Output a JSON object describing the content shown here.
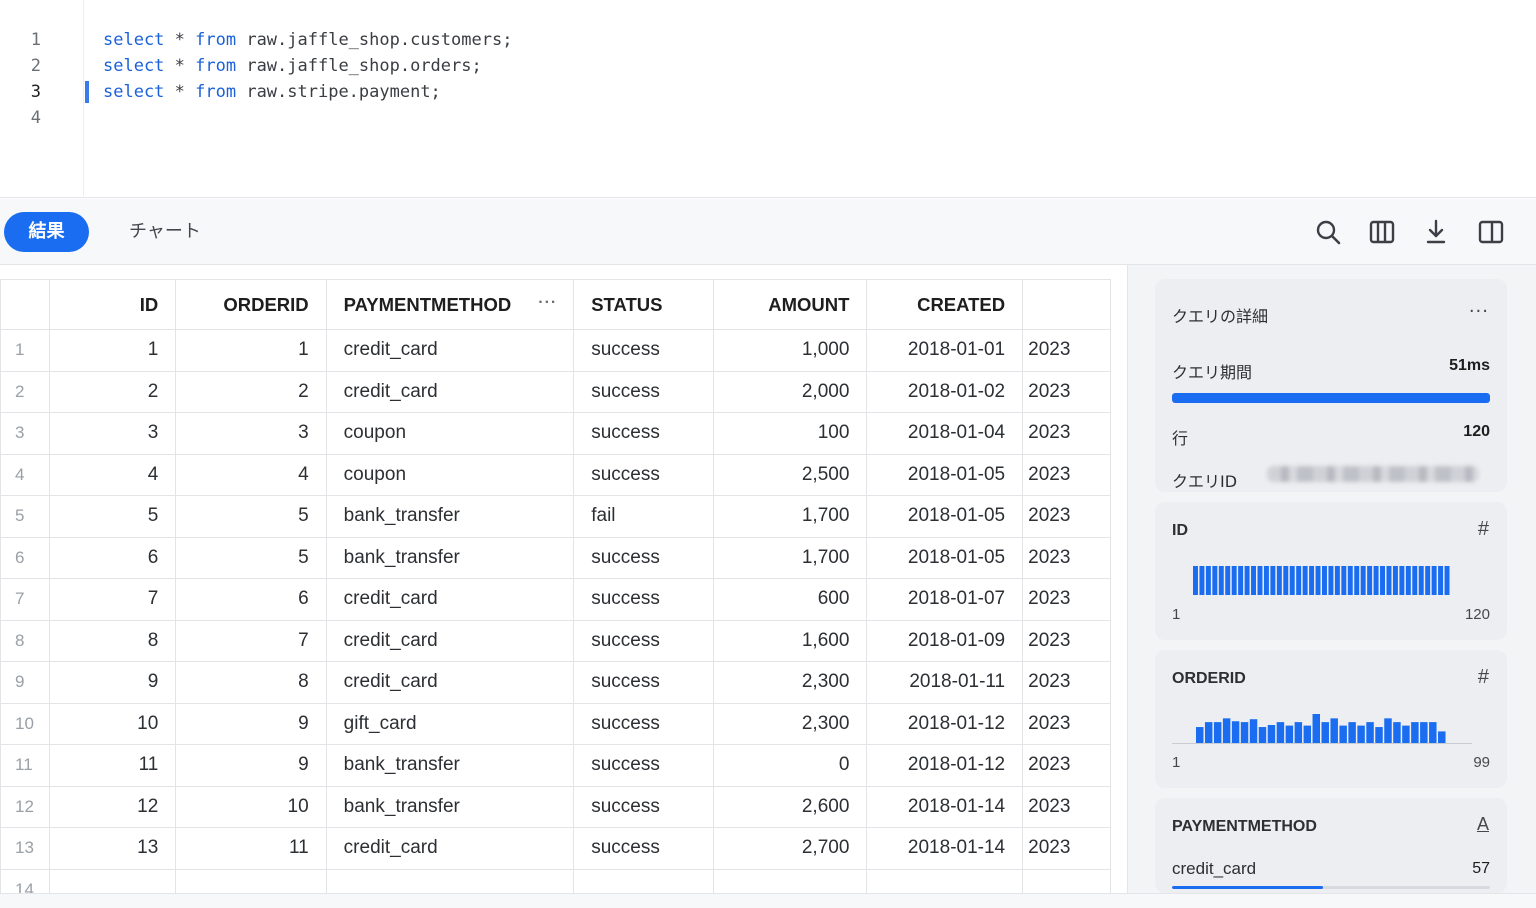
{
  "editor": {
    "lines": [
      {
        "no": "1",
        "kw1": "select",
        "star": " * ",
        "kw2": "from",
        "rest": " raw.jaffle_shop.customers;"
      },
      {
        "no": "2",
        "kw1": "select",
        "star": " * ",
        "kw2": "from",
        "rest": " raw.jaffle_shop.orders;"
      },
      {
        "no": "3",
        "kw1": "select",
        "star": " * ",
        "kw2": "from",
        "rest": " raw.stripe.payment;"
      },
      {
        "no": "4",
        "kw1": "",
        "star": "",
        "kw2": "",
        "rest": ""
      }
    ],
    "active_line": 3
  },
  "toolbar": {
    "tabs": [
      "結果",
      "チャート"
    ],
    "active_tab": "結果",
    "icons": [
      "search-icon",
      "columns-icon",
      "download-icon",
      "side-panel-icon"
    ]
  },
  "grid": {
    "columns": [
      "ID",
      "ORDERID",
      "PAYMENTMETHOD",
      "STATUS",
      "AMOUNT",
      "CREATED"
    ],
    "column_menu": "···",
    "rows": [
      {
        "rn": "1",
        "id": "1",
        "orderid": "1",
        "pm": "credit_card",
        "status": "success",
        "amount": "1,000",
        "created": "2018-01-01",
        "more": "2023"
      },
      {
        "rn": "2",
        "id": "2",
        "orderid": "2",
        "pm": "credit_card",
        "status": "success",
        "amount": "2,000",
        "created": "2018-01-02",
        "more": "2023"
      },
      {
        "rn": "3",
        "id": "3",
        "orderid": "3",
        "pm": "coupon",
        "status": "success",
        "amount": "100",
        "created": "2018-01-04",
        "more": "2023"
      },
      {
        "rn": "4",
        "id": "4",
        "orderid": "4",
        "pm": "coupon",
        "status": "success",
        "amount": "2,500",
        "created": "2018-01-05",
        "more": "2023"
      },
      {
        "rn": "5",
        "id": "5",
        "orderid": "5",
        "pm": "bank_transfer",
        "status": "fail",
        "amount": "1,700",
        "created": "2018-01-05",
        "more": "2023"
      },
      {
        "rn": "6",
        "id": "6",
        "orderid": "5",
        "pm": "bank_transfer",
        "status": "success",
        "amount": "1,700",
        "created": "2018-01-05",
        "more": "2023"
      },
      {
        "rn": "7",
        "id": "7",
        "orderid": "6",
        "pm": "credit_card",
        "status": "success",
        "amount": "600",
        "created": "2018-01-07",
        "more": "2023"
      },
      {
        "rn": "8",
        "id": "8",
        "orderid": "7",
        "pm": "credit_card",
        "status": "success",
        "amount": "1,600",
        "created": "2018-01-09",
        "more": "2023"
      },
      {
        "rn": "9",
        "id": "9",
        "orderid": "8",
        "pm": "credit_card",
        "status": "success",
        "amount": "2,300",
        "created": "2018-01-11",
        "more": "2023"
      },
      {
        "rn": "10",
        "id": "10",
        "orderid": "9",
        "pm": "gift_card",
        "status": "success",
        "amount": "2,300",
        "created": "2018-01-12",
        "more": "2023"
      },
      {
        "rn": "11",
        "id": "11",
        "orderid": "9",
        "pm": "bank_transfer",
        "status": "success",
        "amount": "0",
        "created": "2018-01-12",
        "more": "2023"
      },
      {
        "rn": "12",
        "id": "12",
        "orderid": "10",
        "pm": "bank_transfer",
        "status": "success",
        "amount": "2,600",
        "created": "2018-01-14",
        "more": "2023"
      },
      {
        "rn": "13",
        "id": "13",
        "orderid": "11",
        "pm": "credit_card",
        "status": "success",
        "amount": "2,700",
        "created": "2018-01-14",
        "more": "2023"
      }
    ],
    "partial_row_number": "14"
  },
  "panel": {
    "details": {
      "title": "クエリの詳細",
      "kebab": "···",
      "duration_label": "クエリ期間",
      "duration_value": "51ms",
      "duration_fill": 1.0,
      "rows_label": "行",
      "rows_value": "120",
      "query_id_label": "クエリID"
    },
    "id_card": {
      "title": "ID",
      "type_icon": "#",
      "min": "1",
      "max": "120",
      "bars": [
        1,
        1,
        1,
        1,
        1,
        1,
        1,
        1,
        1,
        1,
        1,
        1,
        1,
        1,
        1,
        1,
        1,
        1,
        1,
        1,
        1,
        1,
        1,
        1,
        1,
        1,
        1,
        1,
        1,
        1,
        1,
        1,
        1,
        1,
        1,
        1,
        1,
        1,
        1,
        1
      ]
    },
    "orderid_card": {
      "title": "ORDERID",
      "type_icon": "#",
      "min": "1",
      "max": "99",
      "bars": [
        0.55,
        0.72,
        0.72,
        0.85,
        0.75,
        0.72,
        0.82,
        0.55,
        0.62,
        0.72,
        0.6,
        0.72,
        0.6,
        1.0,
        0.72,
        0.85,
        0.6,
        0.72,
        0.6,
        0.72,
        0.55,
        0.85,
        0.72,
        0.6,
        0.72,
        0.72,
        0.72,
        0.4
      ]
    },
    "pm_card": {
      "title": "PAYMENTMETHOD",
      "type_icon": "A",
      "top_value": "credit_card",
      "top_count": "57",
      "top_fill": 0.475
    },
    "colors": {
      "accent": "#1a6cf0",
      "card_bg": "#eceef1"
    }
  }
}
